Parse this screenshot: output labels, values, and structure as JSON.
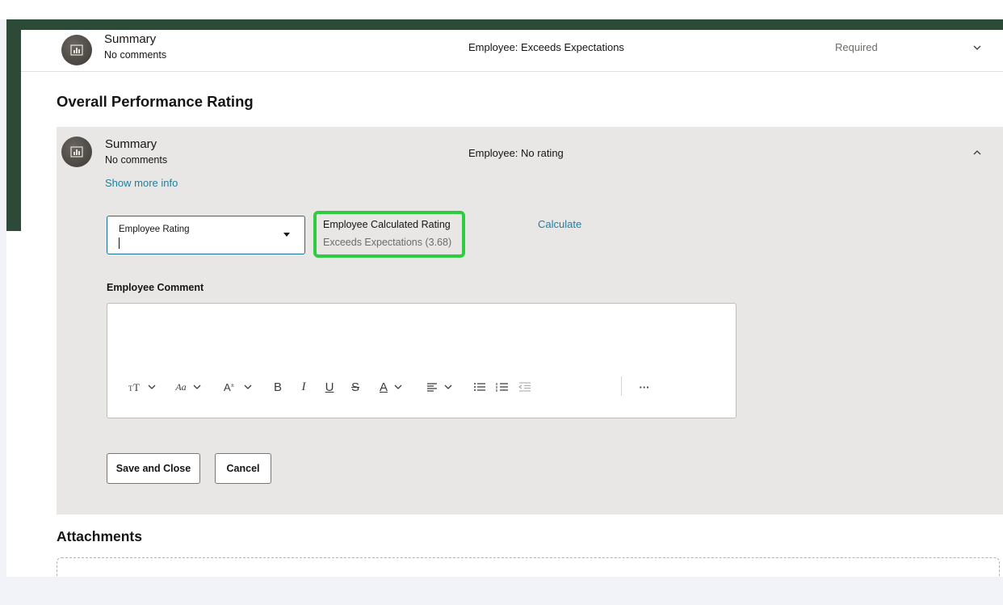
{
  "review_items": [
    {
      "title": "Summary",
      "comments": "No comments",
      "rating_text": "Employee: Exceeds Expectations",
      "status": "Required"
    }
  ],
  "overall": {
    "heading": "Overall Performance Rating",
    "item": {
      "title": "Summary",
      "comments": "No comments",
      "rating_text": "Employee: No rating",
      "show_more": "Show more info"
    },
    "employee_rating": {
      "label": "Employee Rating",
      "value": ""
    },
    "calculated": {
      "title": "Employee Calculated Rating",
      "value": "Exceeds Expectations (3.68)",
      "action": "Calculate"
    },
    "comment": {
      "label": "Employee Comment",
      "value": ""
    },
    "toolbar": {
      "bold": "B",
      "italic": "I",
      "underline": "U",
      "strike": "S",
      "text_color": "A",
      "more": "···",
      "font_family": "Aa"
    },
    "buttons": {
      "save": "Save and Close",
      "cancel": "Cancel"
    }
  },
  "attachments": {
    "heading": "Attachments"
  },
  "colors": {
    "accent": "#227e9e",
    "highlight": "#2ecc40",
    "brand_dark": "#2c4a37"
  }
}
